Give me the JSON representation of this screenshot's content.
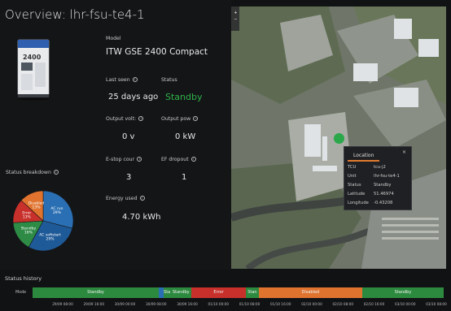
{
  "page": {
    "title": "Overview: lhr-fsu-te4-1"
  },
  "device": {
    "model_label": "Model",
    "model_value": "ITW GSE 2400 Compact",
    "image_text": "2400"
  },
  "metrics": {
    "last_seen_label": "Last seen",
    "last_seen_value": "25 days ago",
    "status_label": "Status",
    "status_value": "Standby",
    "output_volt_label": "Output volt:",
    "output_volt_value": "0 v",
    "output_pow_label": "Output pow",
    "output_pow_value": "0 kW",
    "estop_label": "E-stop cour",
    "estop_value": "3",
    "ef_label": "EF dropout",
    "ef_value": "1",
    "energy_label": "Energy used",
    "energy_value": "4.70 kWh"
  },
  "breakdown": {
    "title": "Status breakdown"
  },
  "chart_data": {
    "type": "pie",
    "slices": [
      {
        "label": "AC run",
        "percent": 29,
        "color": "#2a6fb3"
      },
      {
        "label": "AC softstart",
        "percent": 29,
        "color": "#1f5a98"
      },
      {
        "label": "Standby",
        "percent": 16,
        "color": "#2e8b45"
      },
      {
        "label": "Error",
        "percent": 13,
        "color": "#c8302b"
      },
      {
        "label": "Disabled",
        "percent": 13,
        "color": "#e0742f"
      }
    ],
    "slice_texts": [
      {
        "name": "AC run",
        "pct": "29%"
      },
      {
        "name": "AC softstart",
        "pct": "29%"
      },
      {
        "name": "Standby",
        "pct": "16%"
      },
      {
        "name": "Error",
        "pct": "13%"
      },
      {
        "name": "Disabled",
        "pct": "13%"
      }
    ]
  },
  "location": {
    "title": "Location",
    "close": "×",
    "rows": [
      {
        "k": "TCU",
        "v": "tcu-j2"
      },
      {
        "k": "Unit",
        "v": "lhr-fsu-te4-1"
      },
      {
        "k": "Status",
        "v": "Standby"
      },
      {
        "k": "Latitude",
        "v": "51.46974"
      },
      {
        "k": "Longitude",
        "v": "-0.43208"
      }
    ]
  },
  "map_controls": {
    "zoom_in": "+",
    "zoom_out": "−"
  },
  "history": {
    "title": "Status history",
    "mode_label": "Mode",
    "segments": [
      {
        "label": "Standby",
        "color": "#2c8a3f",
        "start": 0.0,
        "end": 0.307
      },
      {
        "label": "",
        "color": "#2a6fb3",
        "start": 0.307,
        "end": 0.318
      },
      {
        "label": "Sta",
        "color": "#2c8a3f",
        "start": 0.318,
        "end": 0.336
      },
      {
        "label": "Standby",
        "color": "#2c8a3f",
        "start": 0.336,
        "end": 0.386
      },
      {
        "label": "Error",
        "color": "#c8302b",
        "start": 0.386,
        "end": 0.519
      },
      {
        "label": "Stan",
        "color": "#2c8a3f",
        "start": 0.519,
        "end": 0.55
      },
      {
        "label": "Disabled",
        "color": "#e0742f",
        "start": 0.55,
        "end": 0.802
      },
      {
        "label": "Standby",
        "color": "#2c8a3f",
        "start": 0.802,
        "end": 1.0
      }
    ],
    "ticks": [
      "29/09 08:00",
      "29/09 16:00",
      "30/09 00:00",
      "30/09 08:00",
      "30/09 16:00",
      "01/10 00:00",
      "01/10 08:00",
      "01/10 16:00",
      "02/10 00:00",
      "02/10 08:00",
      "02/10 16:00",
      "03/10 00:00",
      "03/10 08:00"
    ]
  }
}
